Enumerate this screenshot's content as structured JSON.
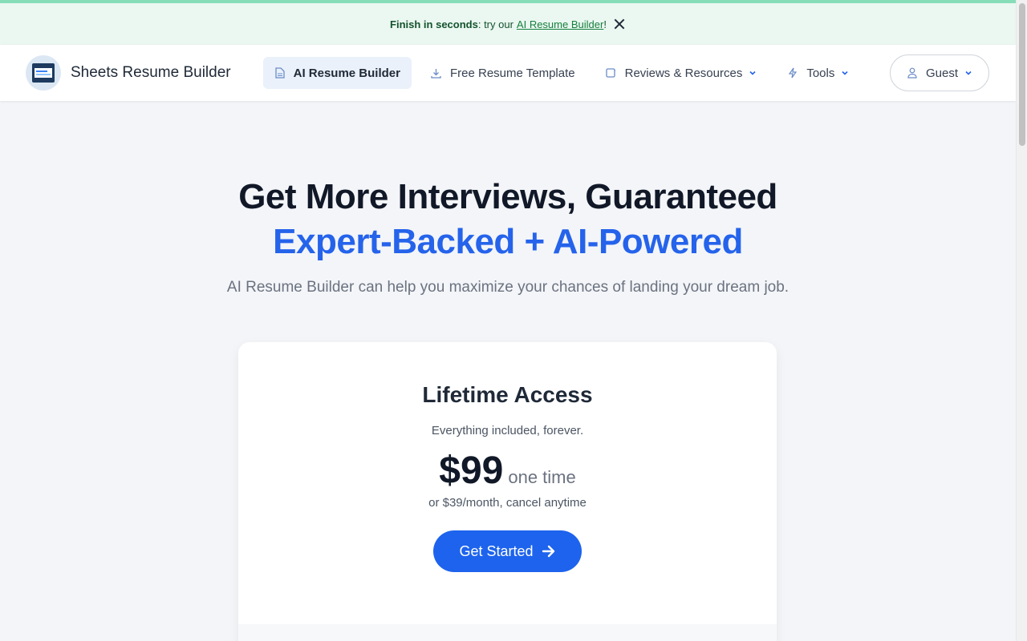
{
  "banner": {
    "bold_text": "Finish in seconds",
    "text": ": try our",
    "link": "AI Resume Builder",
    "suffix": "!"
  },
  "brand": {
    "name": "Sheets Resume Builder"
  },
  "nav": {
    "items": [
      {
        "label": "AI Resume Builder",
        "icon": "document-icon",
        "active": true
      },
      {
        "label": "Free Resume Template",
        "icon": "download-icon"
      },
      {
        "label": "Reviews & Resources",
        "icon": "book-icon",
        "dropdown": true
      },
      {
        "label": "Tools",
        "icon": "lightning-icon",
        "dropdown": true
      }
    ],
    "guest_label": "Guest"
  },
  "hero": {
    "title": "Get More Interviews, Guaranteed",
    "subtitle": "Expert-Backed + AI-Powered",
    "description": "AI Resume Builder can help you maximize your chances of landing your dream job."
  },
  "pricing": {
    "title": "Lifetime Access",
    "subtitle": "Everything included, forever.",
    "price": "$99",
    "price_unit": "one time",
    "alt_price": "or $39/month, cancel anytime",
    "cta_label": "Get Started"
  },
  "colors": {
    "accent": "#1d63ed",
    "headline_blue": "#2563eb",
    "banner_bg": "#ebf7f1",
    "top_line": "#86ddb8"
  }
}
